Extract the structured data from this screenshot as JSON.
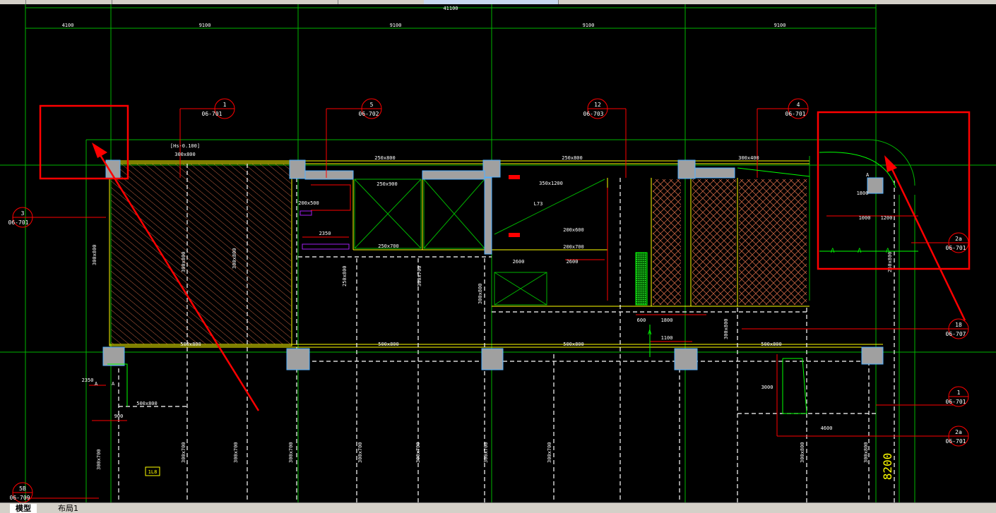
{
  "window": {
    "title": ""
  },
  "drawing": {
    "overall_dimension": "41100",
    "top_dimensions": [
      "4100",
      "9100",
      "9100",
      "9100",
      "9100"
    ],
    "side_dimension": "8200",
    "elevation_note": "[Hs-0.100]",
    "detail_callouts": [
      {
        "num": "1",
        "ref": "06-701"
      },
      {
        "num": "5",
        "ref": "06-702"
      },
      {
        "num": "12",
        "ref": "06-703"
      },
      {
        "num": "4",
        "ref": "06-701"
      },
      {
        "num": "3",
        "ref": "06-701"
      },
      {
        "num": "2a",
        "ref": "06-701"
      },
      {
        "num": "18",
        "ref": "06-707"
      },
      {
        "num": "1",
        "ref": "06-701"
      },
      {
        "num": "2a",
        "ref": "06-701"
      },
      {
        "num": "5B",
        "ref": "06-709"
      }
    ],
    "beam_labels": {
      "top_left": "300x800",
      "top_mid": "250x800",
      "top_mid2": "250x800",
      "top_right": "300x400",
      "mid_row": [
        "500x800",
        "500x800",
        "500x800",
        "500x800",
        "500x800"
      ],
      "small": [
        "250x900",
        "250x700",
        "200x600",
        "200x500",
        "200x700",
        "350x1200",
        "2600",
        "2600",
        "2350",
        "1800",
        "1100",
        "600",
        "L73",
        "1800",
        "1200",
        "1000",
        "900",
        "2350",
        "3000",
        "4600"
      ],
      "vertical": [
        "300x800",
        "300x800",
        "300x800",
        "250x800",
        "300x700",
        "300x800",
        "300x700",
        "300x700",
        "300x700",
        "300x700",
        "300x700",
        "300x700",
        "300x700",
        "300x700",
        "300x800",
        "250x800",
        "300x800",
        "300x800"
      ]
    },
    "section_marks": [
      "A",
      "A",
      "A",
      "A",
      "A",
      "A",
      "A"
    ],
    "room_tag": "1L8",
    "colors": {
      "background": "#000000",
      "gridline": "#00b400",
      "beam": "#ffff00",
      "column": "#a0a0a0",
      "hatch": "#c06040",
      "annotation": "#ff0000",
      "dashed": "#ffffff",
      "callout_circle": "#ff0000",
      "dim_text": "#ffffff"
    }
  },
  "tabs": {
    "model": "模型",
    "layout1": "布局1"
  }
}
